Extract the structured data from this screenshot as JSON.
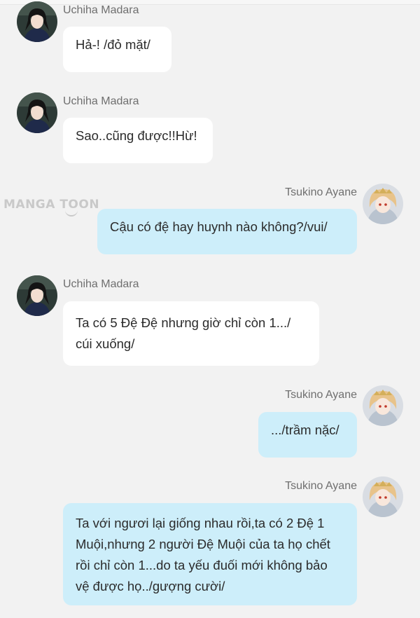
{
  "watermark": "MANGA TOON",
  "messages": [
    {
      "sender": "Uchiha Madara",
      "side": "left",
      "text": "Hả-! /đỏ mặt/"
    },
    {
      "sender": "Uchiha Madara",
      "side": "left",
      "text": "Sao..cũng được!!Hừ!"
    },
    {
      "sender": "Tsukino Ayane",
      "side": "right",
      "text": "Cậu có đệ hay huynh nào không?/vui/"
    },
    {
      "sender": "Uchiha Madara",
      "side": "left",
      "text": "Ta có 5 Đệ Đệ nhưng giờ chỉ còn 1.../ cúi xuống/"
    },
    {
      "sender": "Tsukino Ayane",
      "side": "right",
      "text": ".../trầm nặc/"
    },
    {
      "sender": "Tsukino Ayane",
      "side": "right",
      "text": "Ta với ngươi lại giống nhau rồi,ta có 2 Đệ 1 Muội,nhưng 2 người Đệ Muội của ta họ chết rồi chỉ còn 1...do ta yếu đuối mới không bảo vệ được họ../gượng cười/"
    }
  ]
}
